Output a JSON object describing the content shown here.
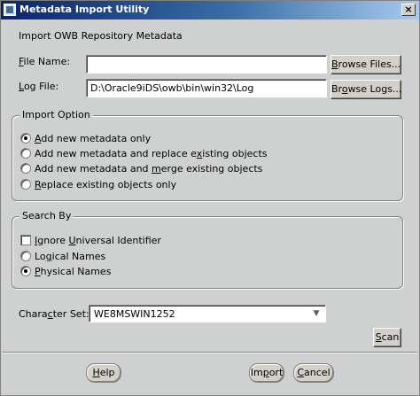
{
  "window": {
    "title": "Metadata Import Utility",
    "close_glyph": "×"
  },
  "header": {
    "text": "Import OWB Repository Metadata"
  },
  "file_name": {
    "label_key": "F",
    "label_rest": "ile Name:",
    "value": "",
    "browse_key": "B",
    "browse_rest": "rowse Files..."
  },
  "log_file": {
    "label_key": "L",
    "label_rest": "og File:",
    "value": "D:\\Oracle9iDS\\owb\\bin\\win32\\Log",
    "browse_pre": "Br",
    "browse_key": "o",
    "browse_rest": "wse Logs..."
  },
  "import_option": {
    "title": "Import Option",
    "options": [
      {
        "pre": "",
        "key": "A",
        "post": "dd new metadata only",
        "selected": true
      },
      {
        "pre": "Add new metadata and replace e",
        "key": "x",
        "post": "isting objects",
        "selected": false
      },
      {
        "pre": "Add new metadata and ",
        "key": "m",
        "post": "erge existing objects",
        "selected": false
      },
      {
        "pre": "",
        "key": "R",
        "post": "eplace existing objects only",
        "selected": false
      }
    ]
  },
  "search_by": {
    "title": "Search By",
    "ignore": {
      "pre": "",
      "key": "I",
      "post": "gnore ",
      "key2": "U",
      "post2": "niversal Identifier",
      "checked": false
    },
    "options": [
      {
        "pre": "Lo",
        "key": "g",
        "post": "ical Names",
        "selected": false
      },
      {
        "pre": "",
        "key": "P",
        "post": "hysical Names",
        "selected": true
      }
    ]
  },
  "charset": {
    "label_pre": "Chara",
    "label_key": "c",
    "label_post": "ter Set:",
    "value": "WE8MSWIN1252",
    "dropdown_glyph": "▼"
  },
  "buttons": {
    "scan_key": "S",
    "scan_rest": "can",
    "help_key": "H",
    "help_rest": "elp",
    "import_pre": "Im",
    "import_key": "p",
    "import_rest": "ort",
    "cancel_key": "C",
    "cancel_rest": "ancel"
  }
}
